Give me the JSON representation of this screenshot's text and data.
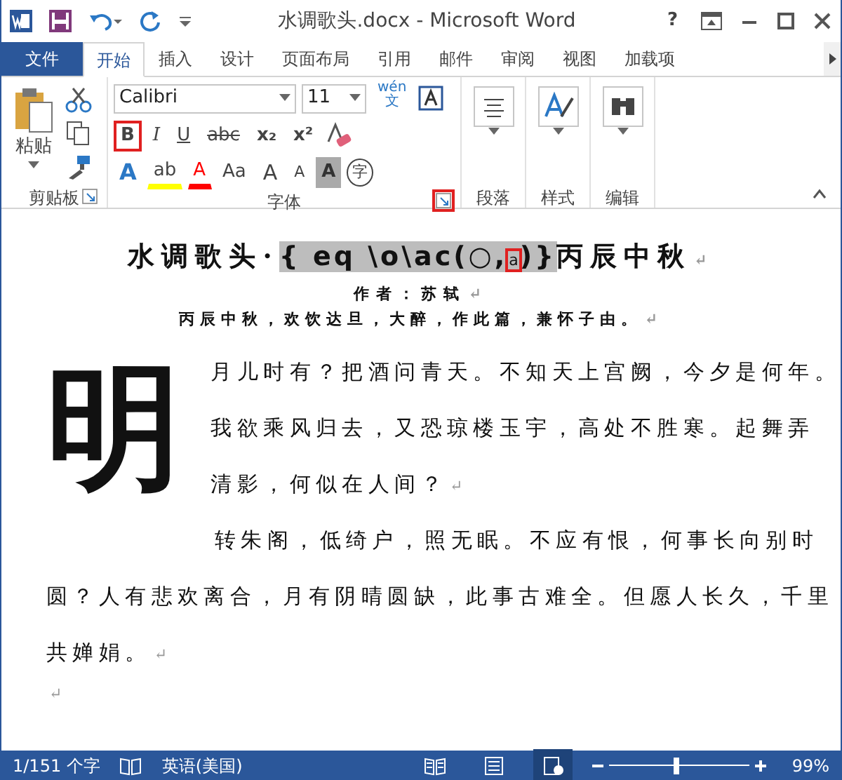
{
  "title_bar": {
    "title": "水调歌头.docx - Microsoft Word",
    "help": "?"
  },
  "tabs": [
    {
      "label": "文件",
      "kind": "file",
      "selected": false
    },
    {
      "label": "开始",
      "kind": "tab",
      "selected": true
    },
    {
      "label": "插入",
      "kind": "tab",
      "selected": false
    },
    {
      "label": "设计",
      "kind": "tab",
      "selected": false
    },
    {
      "label": "页面布局",
      "kind": "tab",
      "selected": false
    },
    {
      "label": "引用",
      "kind": "tab",
      "selected": false
    },
    {
      "label": "邮件",
      "kind": "tab",
      "selected": false
    },
    {
      "label": "审阅",
      "kind": "tab",
      "selected": false
    },
    {
      "label": "视图",
      "kind": "tab",
      "selected": false
    },
    {
      "label": "加载项",
      "kind": "tab",
      "selected": false
    }
  ],
  "ribbon": {
    "clipboard": {
      "paste": "粘贴",
      "label": "剪贴板"
    },
    "font": {
      "font_name": "Calibri",
      "font_size": "11",
      "phonetic_top": "wén",
      "phonetic_bottom": "文",
      "label": "字体",
      "launcher_highlighted": true,
      "row_2": [
        {
          "label": "B",
          "kind": "bold",
          "highlighted": true
        },
        {
          "label": "I",
          "kind": "italic",
          "highlighted": false
        },
        {
          "label": "U",
          "kind": "underline",
          "highlighted": false
        },
        {
          "label": "abc",
          "kind": "strike",
          "highlighted": false
        },
        {
          "label": "x₂",
          "kind": "plain",
          "highlighted": false
        },
        {
          "label": "x²",
          "kind": "plain",
          "highlighted": false
        }
      ],
      "row_3": [
        {
          "label": "A",
          "kind": "effect",
          "color": "#2b78c5"
        },
        {
          "label": "ab",
          "kind": "highlight",
          "color": "#ffff00"
        },
        {
          "label": "A",
          "kind": "fontcolor",
          "color": "#ff0000"
        },
        {
          "label": "Aa",
          "kind": "plain"
        },
        {
          "label": "A",
          "kind": "grow"
        },
        {
          "label": "A",
          "kind": "shrink"
        },
        {
          "label": "A",
          "kind": "shade"
        },
        {
          "label": "字",
          "kind": "enclose"
        }
      ]
    },
    "paragraph": {
      "label": "段落"
    },
    "styles": {
      "label": "样式"
    },
    "editing": {
      "label": "编辑"
    }
  },
  "document": {
    "title": {
      "before": "水调歌头·",
      "field_start": "{ eq \\o\\ac(○,",
      "field_marked": "a",
      "field_end": ")}",
      "after": "丙辰中秋",
      "mark": "↵"
    },
    "author": {
      "text": "作者：苏轼",
      "mark": "↵"
    },
    "preface": {
      "text": "丙辰中秋，欢饮达旦，大醉，作此篇，兼怀子由。",
      "mark": "↵"
    },
    "paragraphs": [
      {
        "kind": "dropcap",
        "drop_cap": "明",
        "lines": [
          "月儿时有？把酒问青天。不知天上宫阙，今夕是何年。",
          "我欲乘风归去，又恐琼楼玉宇，高处不胜寒。起舞弄",
          "清影，何似在人间？"
        ],
        "mark": "↵"
      },
      {
        "kind": "plain",
        "lines": [
          "转朱阁，低绮户，照无眠。不应有恨，何事长向别时",
          "圆？人有悲欢离合，月有阴晴圆缺，此事古难全。但愿人长久，千里",
          "共婵娟。"
        ],
        "mark": "↵"
      },
      {
        "kind": "empty",
        "mark": "↵"
      }
    ]
  },
  "status_bar": {
    "word_count": "1/151 个字",
    "language": "英语(美国)",
    "zoom": "99%",
    "level": 0.48,
    "views": [
      {
        "kind": "read",
        "selected": false
      },
      {
        "kind": "print",
        "selected": false
      },
      {
        "kind": "web",
        "selected": true
      }
    ]
  }
}
